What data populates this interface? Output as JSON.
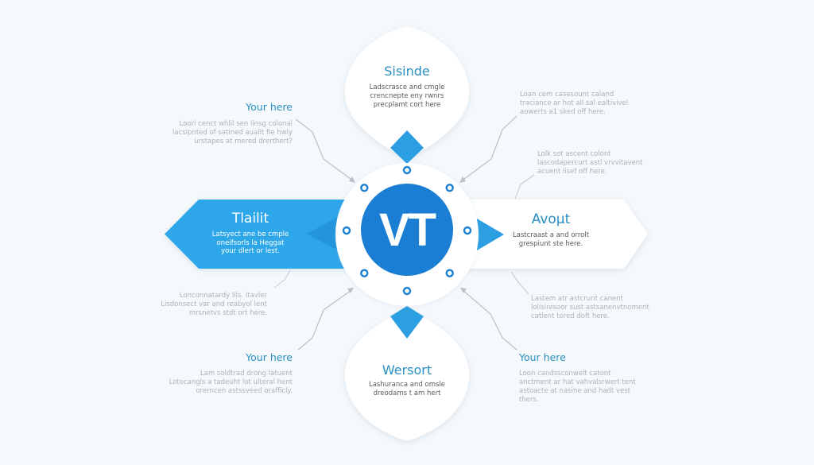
{
  "colors": {
    "background": "#f5f9fc",
    "accent_blue": "#2c9fe3",
    "hub_blue": "#1a7fd4",
    "title_teal": "#2a8fc0",
    "muted_text": "#aab3bb",
    "body_text": "#555b62"
  },
  "hub": {
    "label": "VT",
    "ring_dot_count": 8
  },
  "top_petal": {
    "title": "Sisinde",
    "lines": [
      "Ladscrasce and cmgle",
      "crencnepte eny rwnrs",
      "precplamt cort here"
    ]
  },
  "bottom_petal": {
    "title": "Wersort",
    "lines": [
      "Lashuranca and omsle",
      "dreodams t am hert"
    ]
  },
  "left_arrow": {
    "title": "Tlailit",
    "lines": [
      "Latsyect ane be cmple",
      "oneifsorls la Heggat",
      "your dlert or lest."
    ]
  },
  "right_arrow": {
    "title": "Avoμt",
    "lines": [
      "Lastcraast a and orrolt",
      "grespiunt ste here."
    ]
  },
  "callouts": {
    "top_left": {
      "title": "Your here",
      "lines": [
        "Loorl cenct whlil sen linsg colonal",
        "lacsipnted of satined auallt fie hwly",
        "urstapes at mered drerthert?"
      ]
    },
    "top_right": {
      "title": "",
      "lines": [
        "Loan cem casesount caland",
        "traciance ar hot all sal ealtivivel",
        "aowerts a1 sked off here."
      ]
    },
    "mid_right_upper": {
      "title": "",
      "lines": [
        "Lolk sot ascent colont",
        "lascodapercurt astl vrvvitavent",
        "acuent lisef off here."
      ]
    },
    "mid_left_lower": {
      "title": "",
      "lines": [
        "Lonconnatardy lils. Itavler",
        "Lisdonsect var and reabyol lent",
        "mrsnetvs stdt ort here."
      ]
    },
    "mid_right_lower": {
      "title": "",
      "lines": [
        "Lastem atr astcrunt canent",
        "lolisiresoor sust astsanenvtnoment",
        "catlent tored doft here."
      ]
    },
    "bottom_left": {
      "title": "Your here",
      "lines": [
        "Lam soldtrad drong latuent",
        "Lotocangls a tadeuht lot ulteral hent",
        "orerncen astssveed orafficly."
      ]
    },
    "bottom_right": {
      "title": "Your here",
      "lines": [
        "Loon candssconwelt catont",
        "anctment ar hat vahvalsrwert tent",
        "astoacte at nasine and hadt vest",
        "thers."
      ]
    }
  }
}
